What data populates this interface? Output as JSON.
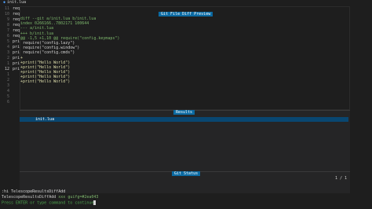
{
  "tabline": {
    "icon": "lua-file-icon",
    "tab_label": "init.lua"
  },
  "buffer": {
    "line_numbers": [
      "11",
      "10",
      "9",
      "8",
      "7",
      "6",
      "5",
      "4",
      "3",
      "2",
      "1",
      "12",
      "1",
      "2",
      "3",
      "4",
      "5",
      "6"
    ],
    "current_line_index": 11,
    "lines": [
      "require(\"config.options\")",
      "req",
      "req",
      "req",
      "req",
      "req",
      "pri",
      "pri",
      "pri",
      "pri",
      "pri",
      "pri",
      "",
      "",
      "",
      "",
      "",
      ""
    ]
  },
  "preview": {
    "title": "Git File Diff Preview",
    "diff_lines": [
      {
        "text": "diff --git a/init.lua b/init.lua",
        "kind": "head"
      },
      {
        "text": "index 0266166..7802171 100644",
        "kind": "head"
      },
      {
        "text": "--- a/init.lua",
        "kind": "head"
      },
      {
        "text": "+++ b/init.lua",
        "kind": "head"
      },
      {
        "text": "@@ -1,5 +1,10 @@ require(\"config.keymaps\")",
        "kind": "hunk"
      },
      {
        "text": " require(\"config.lazy\")",
        "kind": "plain"
      },
      {
        "text": " require(\"config.window\")",
        "kind": "plain"
      },
      {
        "text": " require(\"config.cmds\")",
        "kind": "plain"
      },
      {
        "text": "+",
        "kind": "add"
      },
      {
        "text": "+print(\"Hello World\")",
        "kind": "add"
      },
      {
        "text": "+print(\"Hello World\")",
        "kind": "add"
      },
      {
        "text": "+print(\"Hello World\")",
        "kind": "add"
      },
      {
        "text": "+print(\"Hello World\")",
        "kind": "add"
      },
      {
        "text": "+print(\"Hello World\")",
        "kind": "add"
      }
    ]
  },
  "results": {
    "title": "Results",
    "items": [
      "init.lua"
    ]
  },
  "prompt": {
    "title": "Git Status",
    "counter": "1 / 1"
  },
  "cmdline": {
    "line1": ":hi TelescopeResultsDiffAdd",
    "line2_group": "TelescopeResultsDiffAdd",
    "line2_xxx": "xxx",
    "line2_rest": "guifg=#2ea043",
    "line3": "Press ENTER or type command to continue"
  },
  "colors": {
    "background": "#1e1e1e",
    "panel": "#252526",
    "title_bg": "#0b6aa2",
    "selection": "#094771",
    "diff_green": "#2ea043"
  }
}
